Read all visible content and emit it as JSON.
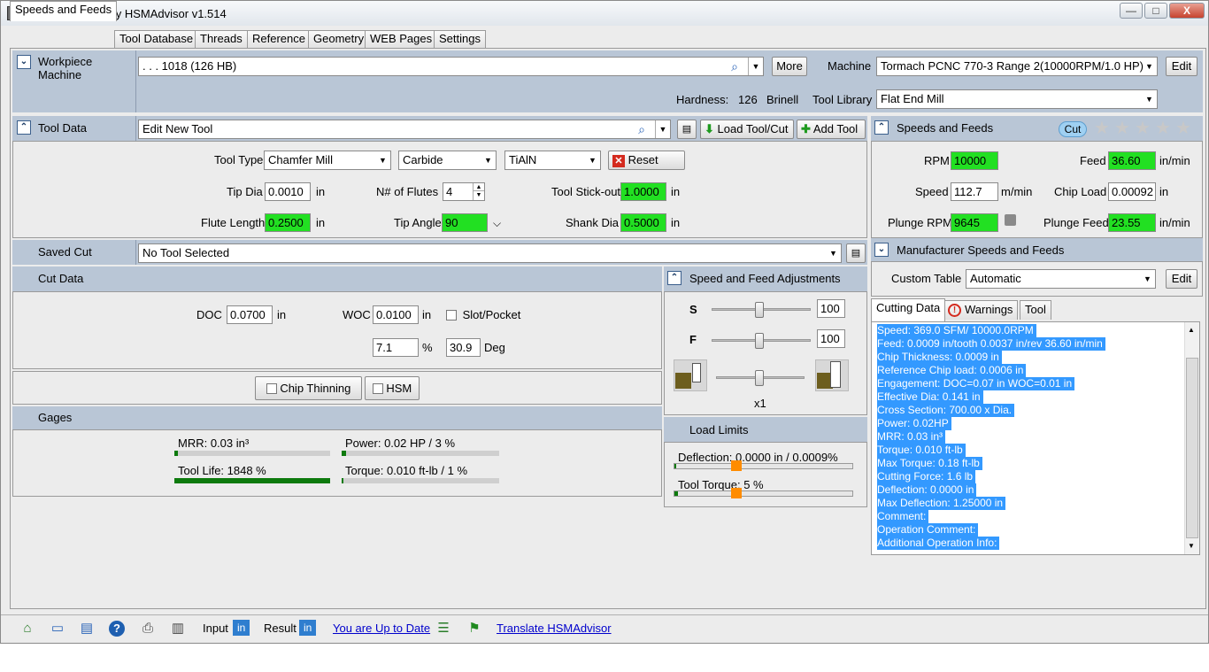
{
  "window": {
    "title": "S10000 F36.60 by HSMAdvisor v1.514",
    "min": "—",
    "max": "□",
    "close": "X"
  },
  "tabs": [
    "Speeds and Feeds",
    "Tool Database",
    "Threads",
    "Reference",
    "Geometry",
    "WEB Pages",
    "Settings"
  ],
  "workpiece": {
    "title_line1": "Workpiece",
    "title_line2": "Machine",
    "material": ". . . 1018 (126 HB)",
    "more_label": "More",
    "machine_label": "Machine",
    "machine_value": "Tormach PCNC 770-3 Range 2(10000RPM/1.0 HP)",
    "edit_label": "Edit",
    "hardness_label": "Hardness:",
    "hardness_value": "126",
    "hardness_unit": "Brinell",
    "tool_library_label": "Tool Library",
    "tool_library_value": "Flat End Mill"
  },
  "tool_data": {
    "title": "Tool Data",
    "tool_name": "Edit New Tool",
    "load_label": "Load Tool/Cut",
    "add_label": "Add Tool",
    "tool_type_label": "Tool Type",
    "tool_type": "Chamfer Mill",
    "material": "Carbide",
    "coating": "TiAlN",
    "reset_label": "Reset",
    "tip_dia_label": "Tip Dia",
    "tip_dia": "0.0010",
    "unit_in": "in",
    "flutes_label": "N# of Flutes",
    "flutes": "4",
    "stickout_label": "Tool Stick-out",
    "stickout": "1.0000",
    "flute_len_label": "Flute Length",
    "flute_len": "0.2500",
    "tip_angle_label": "Tip Angle",
    "tip_angle": "90",
    "shank_label": "Shank Dia",
    "shank": "0.5000"
  },
  "speeds_feeds": {
    "title": "Speeds and Feeds",
    "cut_badge": "Cut",
    "rating": 0,
    "rpm_label": "RPM",
    "rpm": "10000",
    "feed_label": "Feed",
    "feed": "36.60",
    "feed_unit": "in/min",
    "speed_label": "Speed",
    "speed": "112.7",
    "speed_unit": "m/min",
    "chipload_label": "Chip Load",
    "chipload": "0.00092",
    "chipload_unit": "in",
    "plunge_rpm_label": "Plunge RPM",
    "plunge_rpm": "9645",
    "plunge_feed_label": "Plunge Feed",
    "plunge_feed": "23.55",
    "plunge_feed_unit": "in/min"
  },
  "manufacturer": {
    "title": "Manufacturer Speeds and Feeds",
    "custom_table_label": "Custom Table",
    "custom_table_value": "Automatic",
    "edit_label": "Edit"
  },
  "saved_cut": {
    "title": "Saved Cut",
    "value": "No Tool Selected"
  },
  "cut_data": {
    "title": "Cut Data",
    "doc_label": "DOC",
    "doc": "0.0700",
    "doc_unit": "in",
    "woc_label": "WOC",
    "woc": "0.0100",
    "woc_unit": "in",
    "slot_label": "Slot/Pocket",
    "woc_pct": "7.1",
    "pct_unit": "%",
    "deg": "30.9",
    "deg_unit": "Deg",
    "chip_thinning_label": "Chip Thinning",
    "hsm_label": "HSM"
  },
  "adjustments": {
    "title": "Speed and Feed Adjustments",
    "s_label": "S",
    "s_value": "100",
    "f_label": "F",
    "f_value": "100",
    "mult_label": "x1"
  },
  "gages": {
    "title": "Gages",
    "mrr": "MRR: 0.03 in³",
    "power": "Power: 0.02 HP / 3 %",
    "tool_life": "Tool Life: 1848 %",
    "torque": "Torque: 0.010 ft-lb / 1 %",
    "mrr_level": 0.02,
    "power_level": 0.03,
    "tool_life_level": 1.0,
    "torque_level": 0.01
  },
  "load_limits": {
    "title": "Load Limits",
    "deflection": "Deflection: 0.0000 in / 0.0009%",
    "tool_torque": "Tool Torque: 5 %",
    "deflection_level": 0.35,
    "torque_level": 0.35
  },
  "result_tabs": [
    "Cutting Data",
    "Warnings",
    "Tool"
  ],
  "cutting_data": [
    "Speed: 369.0 SFM/ 10000.0RPM",
    "Feed: 0.0009 in/tooth 0.0037 in/rev 36.60 in/min",
    "Chip Thickness: 0.0009 in",
    "Reference Chip load: 0.0006 in",
    "Engagement: DOC=0.07 in  WOC=0.01 in",
    "Effective Dia: 0.141 in",
    "Cross Section: 700.00 x Dia.",
    "Power: 0.02HP",
    "MRR: 0.03 in³",
    "Torque: 0.010 ft-lb",
    "Max Torque: 0.18 ft-lb",
    "Cutting Force: 1.6 lb",
    "Deflection: 0.0000 in",
    "Max Deflection: 1.25000 in",
    "Comment:",
    "Operation Comment:",
    "Additional Operation Info:"
  ],
  "statusbar": {
    "input_label": "Input",
    "input_unit": "in",
    "result_label": "Result",
    "result_unit": "in",
    "update_link": "You are Up to Date",
    "translate_link": "Translate HSMAdvisor"
  },
  "colors": {
    "panel_band": "#b9c6d6",
    "highlight_green": "#22e022",
    "selection_blue": "#3399ff",
    "gage_green": "#0d7a0d",
    "slider_orange": "#ff8c00"
  }
}
